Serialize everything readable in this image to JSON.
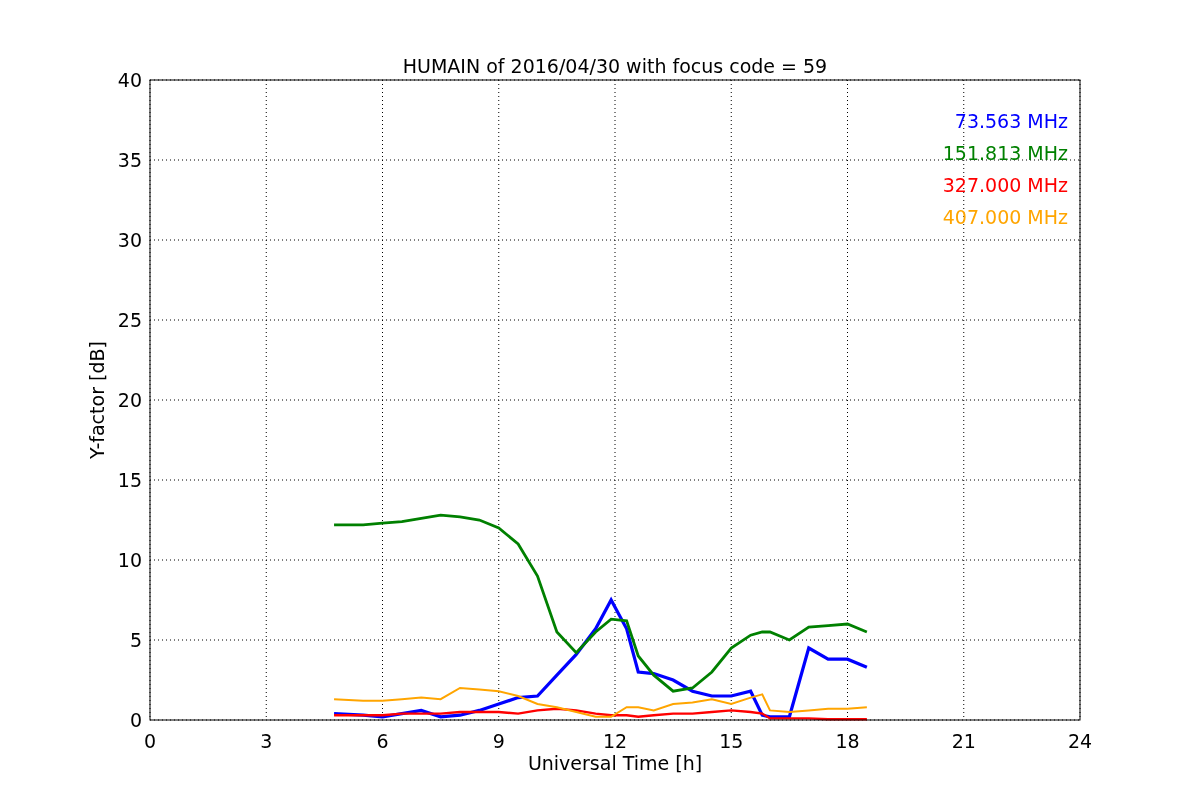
{
  "chart_data": {
    "type": "line",
    "title": "HUMAIN of 2016/04/30 with focus code = 59",
    "xlabel": "Universal Time [h]",
    "ylabel": "Y-factor [dB]",
    "x": [
      4.75,
      5.5,
      6,
      6.5,
      7,
      7.5,
      8,
      8.5,
      9,
      9.5,
      10,
      10.5,
      11,
      11.5,
      11.9,
      12.3,
      12.6,
      13,
      13.5,
      14,
      14.5,
      15,
      15.5,
      15.8,
      16,
      16.5,
      17,
      17.5,
      18,
      18.5
    ],
    "series": [
      {
        "name": "73.563 MHz",
        "color": "#0000ff",
        "values": [
          0.4,
          0.3,
          0.2,
          0.4,
          0.6,
          0.2,
          0.3,
          0.6,
          1.0,
          1.4,
          1.5,
          2.8,
          4.1,
          5.7,
          7.5,
          5.7,
          3.0,
          2.9,
          2.5,
          1.8,
          1.5,
          1.5,
          1.8,
          0.3,
          0.2,
          0.2,
          4.5,
          3.8,
          3.8,
          3.3
        ]
      },
      {
        "name": "151.813 MHz",
        "color": "#008000",
        "values": [
          12.2,
          12.2,
          12.3,
          12.4,
          12.6,
          12.8,
          12.7,
          12.5,
          12.0,
          11.0,
          9.0,
          5.5,
          4.2,
          5.5,
          6.3,
          6.2,
          4.0,
          2.8,
          1.8,
          2.0,
          3.0,
          4.5,
          5.3,
          5.5,
          5.5,
          5.0,
          5.8,
          5.9,
          6.0,
          5.5
        ]
      },
      {
        "name": "327.000 MHz",
        "color": "#ff0000",
        "values": [
          0.3,
          0.3,
          0.3,
          0.4,
          0.4,
          0.4,
          0.5,
          0.5,
          0.5,
          0.4,
          0.6,
          0.7,
          0.6,
          0.4,
          0.3,
          0.3,
          0.2,
          0.3,
          0.4,
          0.4,
          0.5,
          0.6,
          0.5,
          0.4,
          0.1,
          0.1,
          0.1,
          0.05,
          0.05,
          0.05
        ]
      },
      {
        "name": "407.000 MHz",
        "color": "#ffa500",
        "values": [
          1.3,
          1.2,
          1.2,
          1.3,
          1.4,
          1.3,
          2.0,
          1.9,
          1.8,
          1.5,
          1.0,
          0.8,
          0.5,
          0.2,
          0.2,
          0.8,
          0.8,
          0.6,
          1.0,
          1.1,
          1.3,
          1.0,
          1.4,
          1.6,
          0.6,
          0.5,
          0.6,
          0.7,
          0.7,
          0.8
        ]
      }
    ],
    "grid": true,
    "xlim": [
      0,
      24
    ],
    "ylim": [
      0,
      40
    ],
    "xticks": [
      0,
      3,
      6,
      9,
      12,
      15,
      18,
      21,
      24
    ],
    "yticks": [
      0,
      5,
      10,
      15,
      20,
      25,
      30,
      35,
      40
    ]
  }
}
